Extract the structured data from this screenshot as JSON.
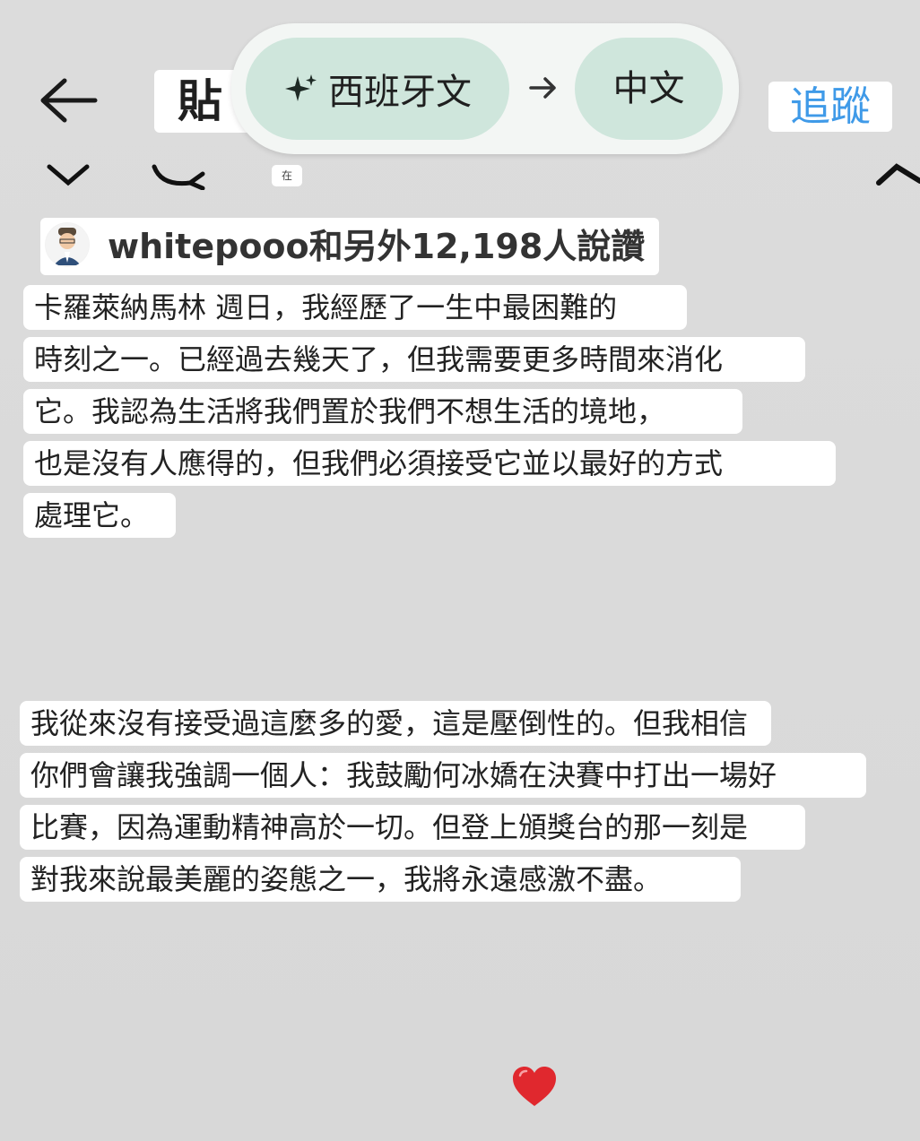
{
  "header": {
    "title": "貼",
    "follow_label": "追蹤"
  },
  "translate": {
    "source_language": "西班牙文",
    "target_language": "中文"
  },
  "tiny_chip": "在",
  "likes": {
    "text": "whitepooo和另外12,198人說讚"
  },
  "caption": {
    "paragraph1": [
      "卡羅萊納馬林 週日，我經歷了一生中最困難的",
      "時刻之一。已經過去幾天了，但我需要更多時間來消化",
      "它。我認為生活將我們置於我們不想生活的境地，",
      "也是沒有人應得的，但我們必須接受它並以最好的方式",
      "處理它。"
    ],
    "paragraph2": [
      "我從來沒有接受過這麼多的愛，這是壓倒性的。但我相信",
      "你們會讓我強調一個人：我鼓勵何冰嬌在決賽中打出一場好",
      "比賽，因為運動精神高於一切。但登上頒獎台的那一刻是",
      "對我來說最美麗的姿態之一，我將永遠感激不盡。"
    ]
  },
  "icons": {
    "back": "arrow-left-icon",
    "sparkle": "sparkle-icon",
    "arrow": "arrow-right-icon",
    "heart": "heart-icon"
  },
  "colors": {
    "background": "#d9d9d9",
    "pill": "#cfe6dc",
    "follow": "#3f9ae8",
    "heart": "#e0282e"
  }
}
